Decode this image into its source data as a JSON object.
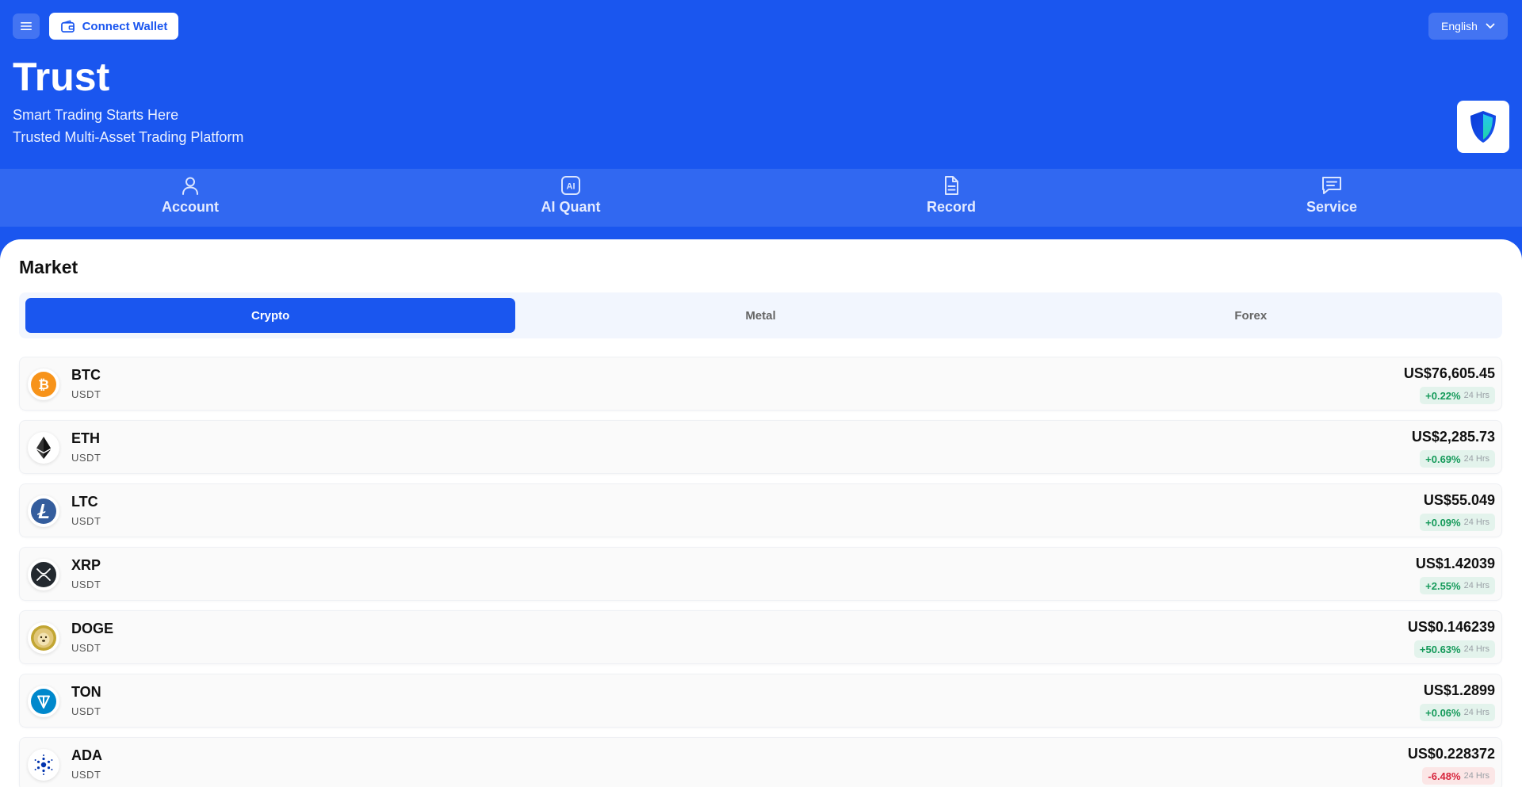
{
  "header": {
    "connect_label": "Connect Wallet",
    "language": "English",
    "brand": "Trust",
    "tagline1": "Smart Trading Starts Here",
    "tagline2": "Trusted Multi-Asset Trading Platform"
  },
  "nav": {
    "items": [
      {
        "label": "Account",
        "icon": "user-icon"
      },
      {
        "label": "AI Quant",
        "icon": "ai-icon"
      },
      {
        "label": "Record",
        "icon": "document-icon"
      },
      {
        "label": "Service",
        "icon": "chat-icon"
      }
    ]
  },
  "market": {
    "title": "Market",
    "tabs": [
      "Crypto",
      "Metal",
      "Forex"
    ],
    "active_tab": "Crypto",
    "period_label": "24 Hrs",
    "coins": [
      {
        "symbol": "BTC",
        "quote": "USDT",
        "price": "US$76,605.45",
        "change": "+0.22%",
        "direction": "up",
        "icon": "bitcoin-icon",
        "color": "#f7931a"
      },
      {
        "symbol": "ETH",
        "quote": "USDT",
        "price": "US$2,285.73",
        "change": "+0.69%",
        "direction": "up",
        "icon": "ethereum-icon",
        "color": "#222222"
      },
      {
        "symbol": "LTC",
        "quote": "USDT",
        "price": "US$55.049",
        "change": "+0.09%",
        "direction": "up",
        "icon": "litecoin-icon",
        "color": "#345d9d"
      },
      {
        "symbol": "XRP",
        "quote": "USDT",
        "price": "US$1.42039",
        "change": "+2.55%",
        "direction": "up",
        "icon": "xrp-icon",
        "color": "#23292f"
      },
      {
        "symbol": "DOGE",
        "quote": "USDT",
        "price": "US$0.146239",
        "change": "+50.63%",
        "direction": "up",
        "icon": "dogecoin-icon",
        "color": "#c2a633"
      },
      {
        "symbol": "TON",
        "quote": "USDT",
        "price": "US$1.2899",
        "change": "+0.06%",
        "direction": "up",
        "icon": "toncoin-icon",
        "color": "#0088cc"
      },
      {
        "symbol": "ADA",
        "quote": "USDT",
        "price": "US$0.228372",
        "change": "-6.48%",
        "direction": "down",
        "icon": "cardano-icon",
        "color": "#0033ad"
      }
    ]
  },
  "colors": {
    "brand_blue": "#1a56ef",
    "up": "#159a5a",
    "down": "#d7263d"
  }
}
